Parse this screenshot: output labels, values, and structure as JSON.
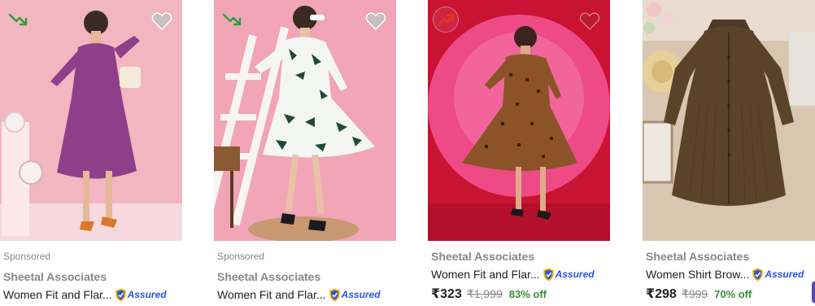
{
  "products": [
    {
      "sponsored": "Sponsored",
      "brand": "Sheetal Associates",
      "title": "Women Fit and Flar...",
      "assured": "Assured",
      "trend_icon": "trend-down-icon",
      "wishlist_icon": "heart-icon"
    },
    {
      "sponsored": "Sponsored",
      "brand": "Sheetal Associates",
      "title": "Women Fit and Flar...",
      "assured": "Assured",
      "trend_icon": "trend-down-icon",
      "wishlist_icon": "heart-icon"
    },
    {
      "brand": "Sheetal Associates",
      "title": "Women Fit and Flar...",
      "assured": "Assured",
      "price": "₹323",
      "mrp": "₹1,999",
      "discount": "83% off",
      "trend_icon": "trend-up-icon",
      "wishlist_icon": "heart-icon"
    },
    {
      "brand": "Sheetal Associates",
      "title": "Women Shirt Brow...",
      "assured": "Assured",
      "price": "₹298",
      "mrp": "₹999",
      "discount": "70% off"
    }
  ],
  "colors": {
    "brand_grey": "#878787",
    "discount_green": "#388e3c",
    "assured_blue": "#2a55e5",
    "trend_down_green": "#2e9e3c",
    "trend_up_red": "#e8331f"
  }
}
